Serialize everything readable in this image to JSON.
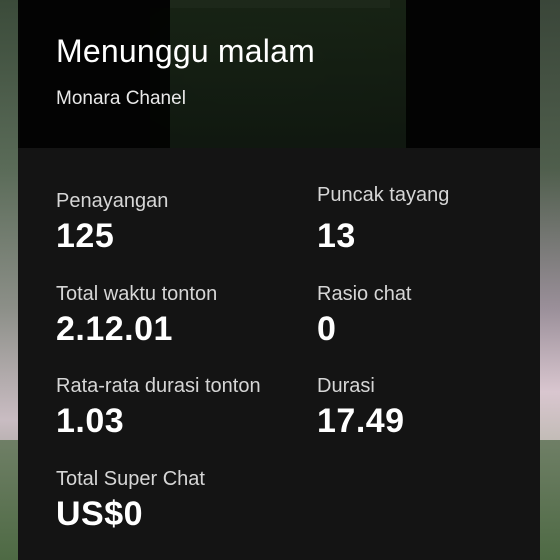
{
  "video": {
    "title": "Menunggu malam",
    "channel": "Monara Chanel"
  },
  "stats": [
    {
      "label": "Penayangan",
      "value": "125"
    },
    {
      "label": "Puncak tayang",
      "value": "13"
    },
    {
      "label": "Total waktu tonton",
      "value": "2.12.01"
    },
    {
      "label": "Rasio chat",
      "value": "0"
    },
    {
      "label": "Rata-rata durasi tonton",
      "value": "1.03"
    },
    {
      "label": "Durasi",
      "value": "17.49"
    },
    {
      "label": "Total Super Chat",
      "value": "US$0"
    }
  ]
}
